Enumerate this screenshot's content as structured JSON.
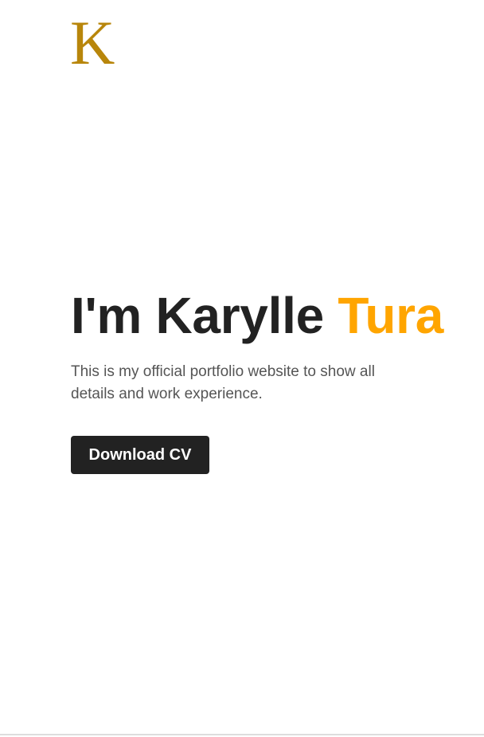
{
  "brand": {
    "logo_letter": "K",
    "logo_color": "#b8860b",
    "logo_icon": "k-monogram-logo"
  },
  "hero": {
    "title_prefix": "I'm Karylle ",
    "title_accent": "Tura",
    "accent_color": "#ffa500",
    "description": "This is my official portfolio website to show all details and work experience.",
    "cta_label": "Download CV"
  }
}
